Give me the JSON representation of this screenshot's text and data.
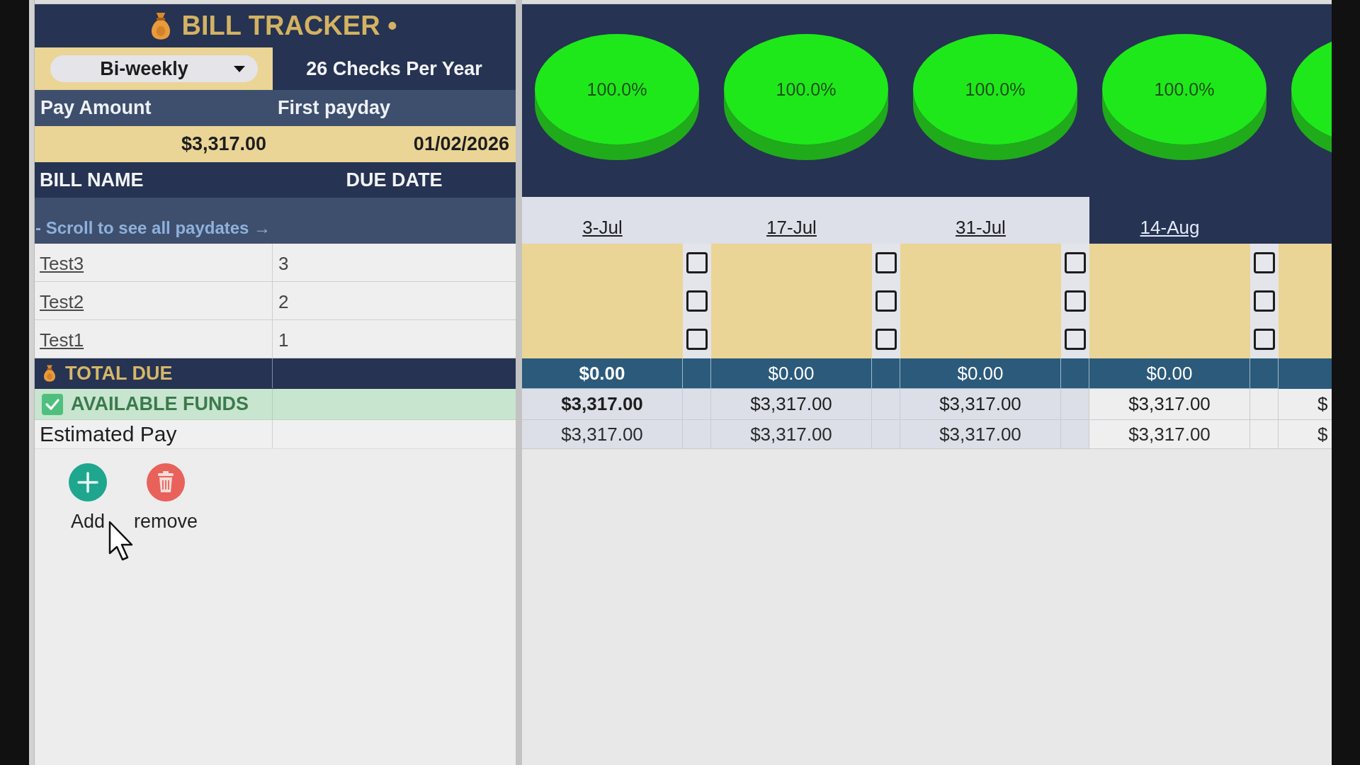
{
  "title": "BILL TRACKER •",
  "pay_frequency": {
    "value": "Bi-weekly"
  },
  "checks_per_year": "26 Checks Per Year",
  "pay_table": {
    "columns": [
      "Pay Amount",
      "First payday"
    ],
    "values": [
      "$3,317.00",
      "01/02/2026"
    ]
  },
  "bill_table": {
    "columns": [
      "BILL NAME",
      "DUE DATE"
    ],
    "scroll_hint": "- Scroll to see all paydates →",
    "rows": [
      {
        "name": "Test3",
        "due_date": "3"
      },
      {
        "name": "Test2",
        "due_date": "2"
      },
      {
        "name": "Test1",
        "due_date": "1"
      }
    ]
  },
  "summary_rows": [
    {
      "kind": "total",
      "label": "TOTAL DUE"
    },
    {
      "kind": "available",
      "label": "AVAILABLE FUNDS"
    },
    {
      "kind": "estimated",
      "label": "Estimated Pay"
    }
  ],
  "paydates": [
    {
      "date": "3-Jul",
      "highlighted": false,
      "emphasized": true,
      "chart_data": {
        "type": "pie",
        "values": [
          100
        ],
        "value_labels": [
          "100.0%"
        ]
      },
      "checks": [
        {
          "checked": false
        },
        {
          "checked": false
        },
        {
          "checked": false
        }
      ],
      "total": "$0.00",
      "available": "$3,317.00",
      "estimated": "$3,317.00"
    },
    {
      "date": "17-Jul",
      "highlighted": false,
      "emphasized": false,
      "chart_data": {
        "type": "pie",
        "values": [
          100
        ],
        "value_labels": [
          "100.0%"
        ]
      },
      "checks": [
        {
          "checked": false
        },
        {
          "checked": false
        },
        {
          "checked": false
        }
      ],
      "total": "$0.00",
      "available": "$3,317.00",
      "estimated": "$3,317.00"
    },
    {
      "date": "31-Jul",
      "highlighted": false,
      "emphasized": false,
      "chart_data": {
        "type": "pie",
        "values": [
          100
        ],
        "value_labels": [
          "100.0%"
        ]
      },
      "checks": [
        {
          "checked": false
        },
        {
          "checked": false
        },
        {
          "checked": false
        }
      ],
      "total": "$0.00",
      "available": "$3,317.00",
      "estimated": "$3,317.00"
    },
    {
      "date": "14-Aug",
      "highlighted": true,
      "emphasized": false,
      "chart_data": {
        "type": "pie",
        "values": [
          100
        ],
        "value_labels": [
          "100.0%"
        ]
      },
      "checks": [
        {
          "checked": false
        },
        {
          "checked": false
        },
        {
          "checked": false
        }
      ],
      "total": "$0.00",
      "available": "$3,317.00",
      "estimated": "$3,317.00"
    },
    {
      "highlighted": true,
      "emphasized": false,
      "chart_data": {
        "type": "pie",
        "values": [
          100
        ]
      },
      "available": "$",
      "estimated": "$"
    }
  ],
  "actions": [
    {
      "kind": "add",
      "label": "Add"
    },
    {
      "kind": "remove",
      "label": "remove"
    }
  ]
}
